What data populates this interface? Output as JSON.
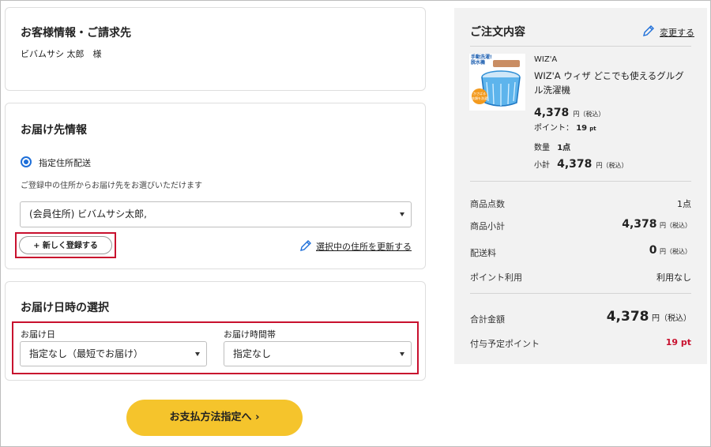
{
  "customer": {
    "heading": "お客様情報・ご請求先",
    "name": "ビバムサシ 太郎　様"
  },
  "delivery": {
    "heading": "お届け先情報",
    "radio_label": "指定住所配送",
    "helper_text": "ご登録中の住所からお届け先をお選びいただけます",
    "address_selected": "(会員住所) ビバムサシ太郎,",
    "new_register_label": "+ 新しく登録する",
    "update_address_label": "選択中の住所を更新する"
  },
  "datetime": {
    "heading": "お届け日時の選択",
    "date_label": "お届け日",
    "date_value": "指定なし（最短でお届け）",
    "time_label": "お届け時間帯",
    "time_value": "指定なし"
  },
  "pay_button_label": "お支払方法指定へ ›",
  "order": {
    "heading": "ご注文内容",
    "change_label": "変更する",
    "product": {
      "image_text_top": "手動洗濯!\n脱水機",
      "image_badge": "かさばる\n衣類を洗濯",
      "brand": "WIZ'A",
      "name": "WIZ'A ウィザ どこでも使えるグルグル洗濯機",
      "price": "4,378",
      "price_unit": "円（税込）",
      "points_label": "ポイント：",
      "points_value": "19",
      "points_unit": "pt",
      "qty_label": "数量",
      "qty_value": "1点",
      "subtotal_label": "小計",
      "subtotal_value": "4,378",
      "subtotal_unit": "円（税込）"
    },
    "rows": {
      "count_label": "商品点数",
      "count_value": "1点",
      "subtotal_label": "商品小計",
      "subtotal_value": "4,378",
      "subtotal_unit": "円（税込）",
      "shipping_label": "配送料",
      "shipping_value": "0",
      "shipping_unit": "円（税込）",
      "point_use_label": "ポイント利用",
      "point_use_value": "利用なし"
    },
    "total_label": "合計金額",
    "total_value": "4,378",
    "total_unit": "円（税込）",
    "grant_points_label": "付与予定ポイント",
    "grant_points_value": "19 pt"
  },
  "colors": {
    "accent_blue": "#1e6fd9",
    "highlight_red": "#c8102e",
    "button_yellow": "#f5c42c",
    "points_red": "#c8102e"
  }
}
